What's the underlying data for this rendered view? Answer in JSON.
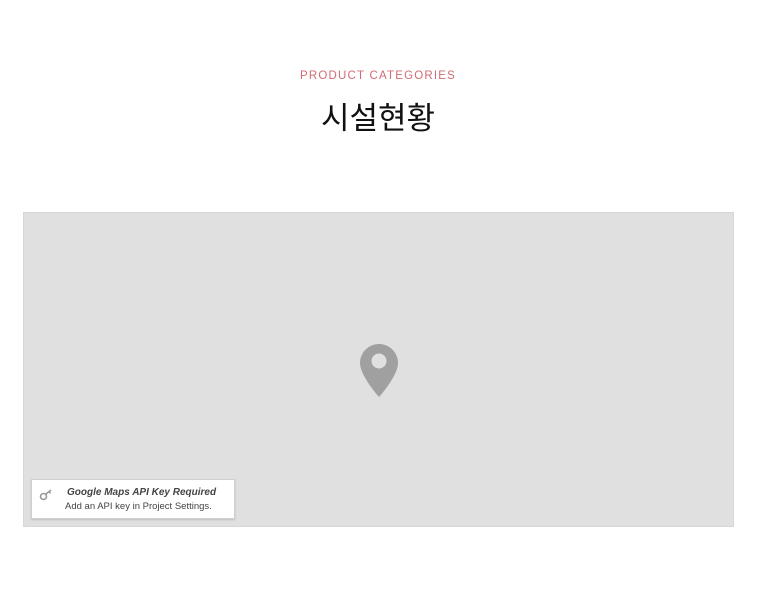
{
  "section": {
    "eyebrow": "PRODUCT CATEGORIES",
    "title": "시설현황"
  },
  "map": {
    "pin_icon": "map-pin-icon",
    "notice": {
      "icon": "key-icon",
      "title": "Google Maps API Key Required",
      "text": "Add an API key in Project Settings."
    }
  },
  "colors": {
    "eyebrow": "#d06b73",
    "map_background": "#e0e0e0",
    "pin": "#a0a0a0"
  }
}
